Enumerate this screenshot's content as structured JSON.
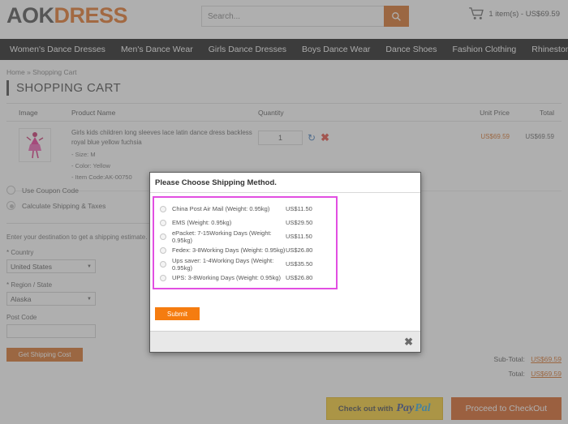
{
  "header": {
    "logo_part1": "AOK",
    "logo_part2": "DRESS",
    "search_placeholder": "Search...",
    "search_value": "",
    "search_icon": "search-icon",
    "cart_icon": "cart-icon",
    "cart_summary": "1 item(s) - US$69.59"
  },
  "nav": {
    "items": [
      {
        "label": "Women's Dance Dresses"
      },
      {
        "label": "Men's Dance Wear"
      },
      {
        "label": "Girls Dance Dresses"
      },
      {
        "label": "Boys Dance Wear"
      },
      {
        "label": "Dance Shoes"
      },
      {
        "label": "Fashion Clothing"
      },
      {
        "label": "Rhinestones Accessories"
      }
    ]
  },
  "breadcrumb": {
    "home": "Home",
    "separator": "»",
    "current": "Shopping Cart"
  },
  "page_title": "SHOPPING CART",
  "cart_table": {
    "columns": {
      "image": "Image",
      "product_name": "Product Name",
      "quantity": "Quantity",
      "unit_price": "Unit Price",
      "total": "Total"
    },
    "rows": [
      {
        "thumb_icon": "dress-thumbnail",
        "name": "Girls kids children long sleeves lace latin dance dress backless royal blue yellow fuchsia",
        "size": "- Size: M",
        "color": "- Color:  Yellow",
        "item_code": "- Item Code:AK-00750",
        "quantity": "1",
        "refresh_icon": "refresh-icon",
        "delete_icon": "delete-icon",
        "unit_price": "US$69.59",
        "total": "US$69.59"
      }
    ]
  },
  "estimate_panel": {
    "coupon_label": "Use Coupon Code",
    "shipping_label": "Calculate Shipping & Taxes",
    "hint": "Enter your destination to get a shipping estimate.",
    "country_label": "* Country",
    "country_value": "United States",
    "region_label": "* Region / State",
    "region_value": "Alaska",
    "postcode_label": "Post Code",
    "postcode_value": "",
    "get_cost_button": "Get Shipping Cost"
  },
  "totals": {
    "subtotal_label": "Sub-Total:",
    "subtotal_value": "US$69.59",
    "total_label": "Total:",
    "total_value": "US$69.59"
  },
  "checkout": {
    "paypal_prefix": "Check out with",
    "paypal_pay": "Pay",
    "paypal_pal": "Pal",
    "proceed_label": "Proceed to CheckOut"
  },
  "modal": {
    "title": "Please Choose Shipping Method.",
    "highlight_color": "#e24fe2",
    "options": [
      {
        "label": "China Post Air Mail (Weight: 0.95kg)",
        "price": "US$11.50"
      },
      {
        "label": "EMS (Weight: 0.95kg)",
        "price": "US$29.50"
      },
      {
        "label": "ePacket: 7-15Working Days (Weight: 0.95kg)",
        "price": "US$11.50"
      },
      {
        "label": "Fedex: 3-8Working Days (Weight: 0.95kg)",
        "price": "US$26.80"
      },
      {
        "label": "Ups saver: 1-4Working Days (Weight: 0.95kg)",
        "price": "US$35.50"
      },
      {
        "label": "UPS: 3-8Working Days (Weight: 0.95kg)",
        "price": "US$26.80"
      }
    ],
    "submit_label": "Submit",
    "close_icon": "close-icon",
    "close_glyph": "✖"
  }
}
